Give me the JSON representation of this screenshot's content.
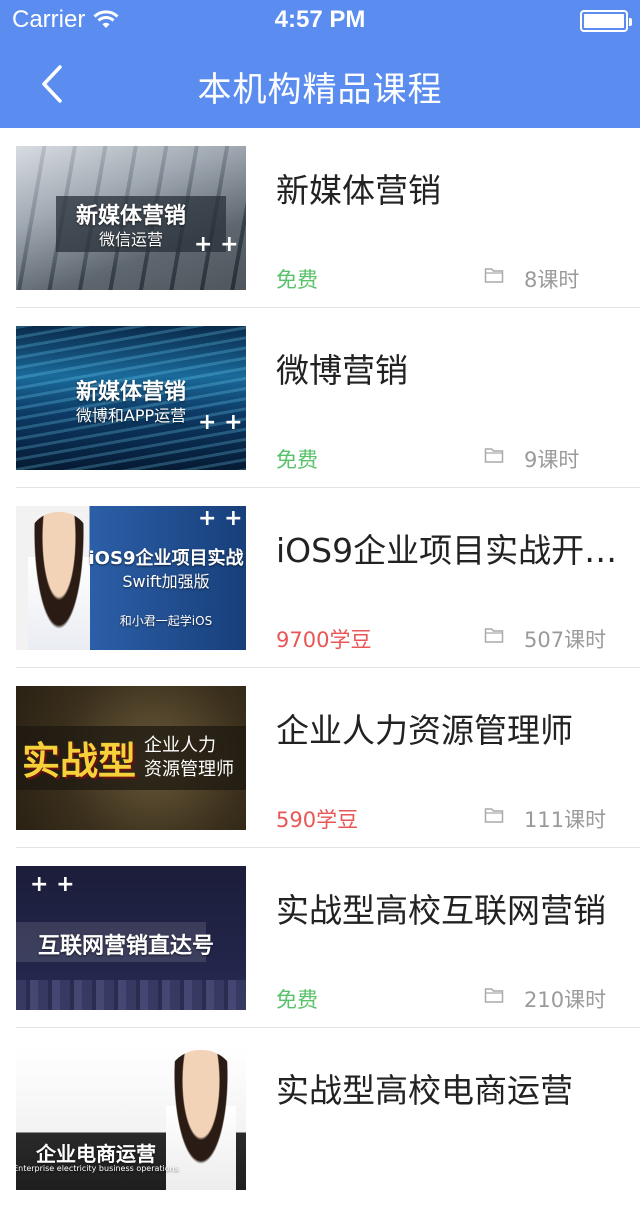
{
  "status_bar": {
    "carrier": "Carrier",
    "time": "4:57 PM"
  },
  "nav": {
    "title": "本机构精品课程",
    "back_icon": "chevron-left-icon"
  },
  "colors": {
    "header": "#5b8df0",
    "free": "#58c26b",
    "paid": "#e85656",
    "meta": "#9a9a9a"
  },
  "courses": [
    {
      "title": "新媒体营销",
      "price": "免费",
      "price_type": "free",
      "hours": "8课时",
      "thumb_line1": "新媒体营销",
      "thumb_line2": "微信运营"
    },
    {
      "title": "微博营销",
      "price": "免费",
      "price_type": "free",
      "hours": "9课时",
      "thumb_line1": "新媒体营销",
      "thumb_line2": "微博和APP运营"
    },
    {
      "title": "iOS9企业项目实战开…",
      "price": "9700学豆",
      "price_type": "paid",
      "hours": "507课时",
      "thumb_line1": "iOS9企业项目实战",
      "thumb_line2": "Swift加强版",
      "thumb_line3": "和小君一起学iOS"
    },
    {
      "title": "企业人力资源管理师",
      "price": "590学豆",
      "price_type": "paid",
      "hours": "111课时",
      "thumb_line1": "实战型",
      "thumb_line2": "企业人力",
      "thumb_line3": "资源管理师"
    },
    {
      "title": "实战型高校互联网营销",
      "price": "免费",
      "price_type": "free",
      "hours": "210课时",
      "thumb_line1": "互联网营销直达号"
    },
    {
      "title": "实战型高校电商运营",
      "price": "",
      "price_type": "free",
      "hours": "",
      "thumb_line1": "企业电商运营",
      "thumb_line2": "Enterprise electricity business operations"
    }
  ]
}
